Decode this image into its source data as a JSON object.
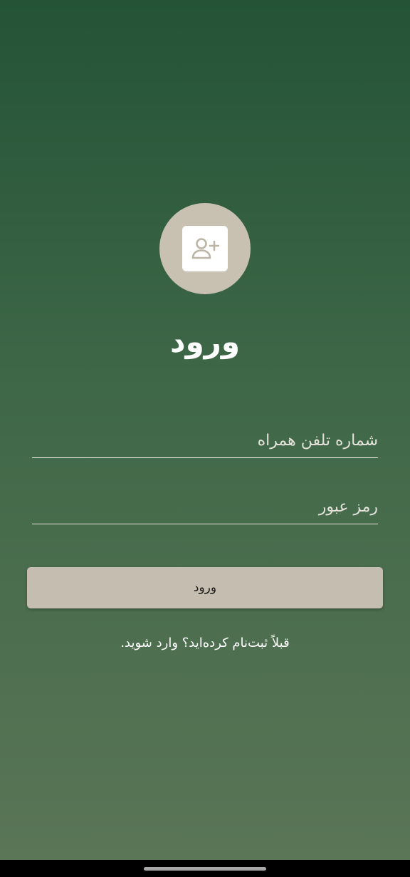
{
  "colors": {
    "background_top": "#245336",
    "background_bottom": "#5b7657",
    "accent_beige": "#c8c0b1",
    "button_bg": "#c5beb0",
    "text_light": "#ffffff"
  },
  "avatar": {
    "icon": "person-add-icon"
  },
  "title": "ورود",
  "form": {
    "phone_placeholder": "شماره تلفن همراه",
    "password_placeholder": "رمز عبور",
    "submit_label": "ورود"
  },
  "footer_link": "قبلاً ثبت‌نام کرده‌اید؟ وارد شوید."
}
